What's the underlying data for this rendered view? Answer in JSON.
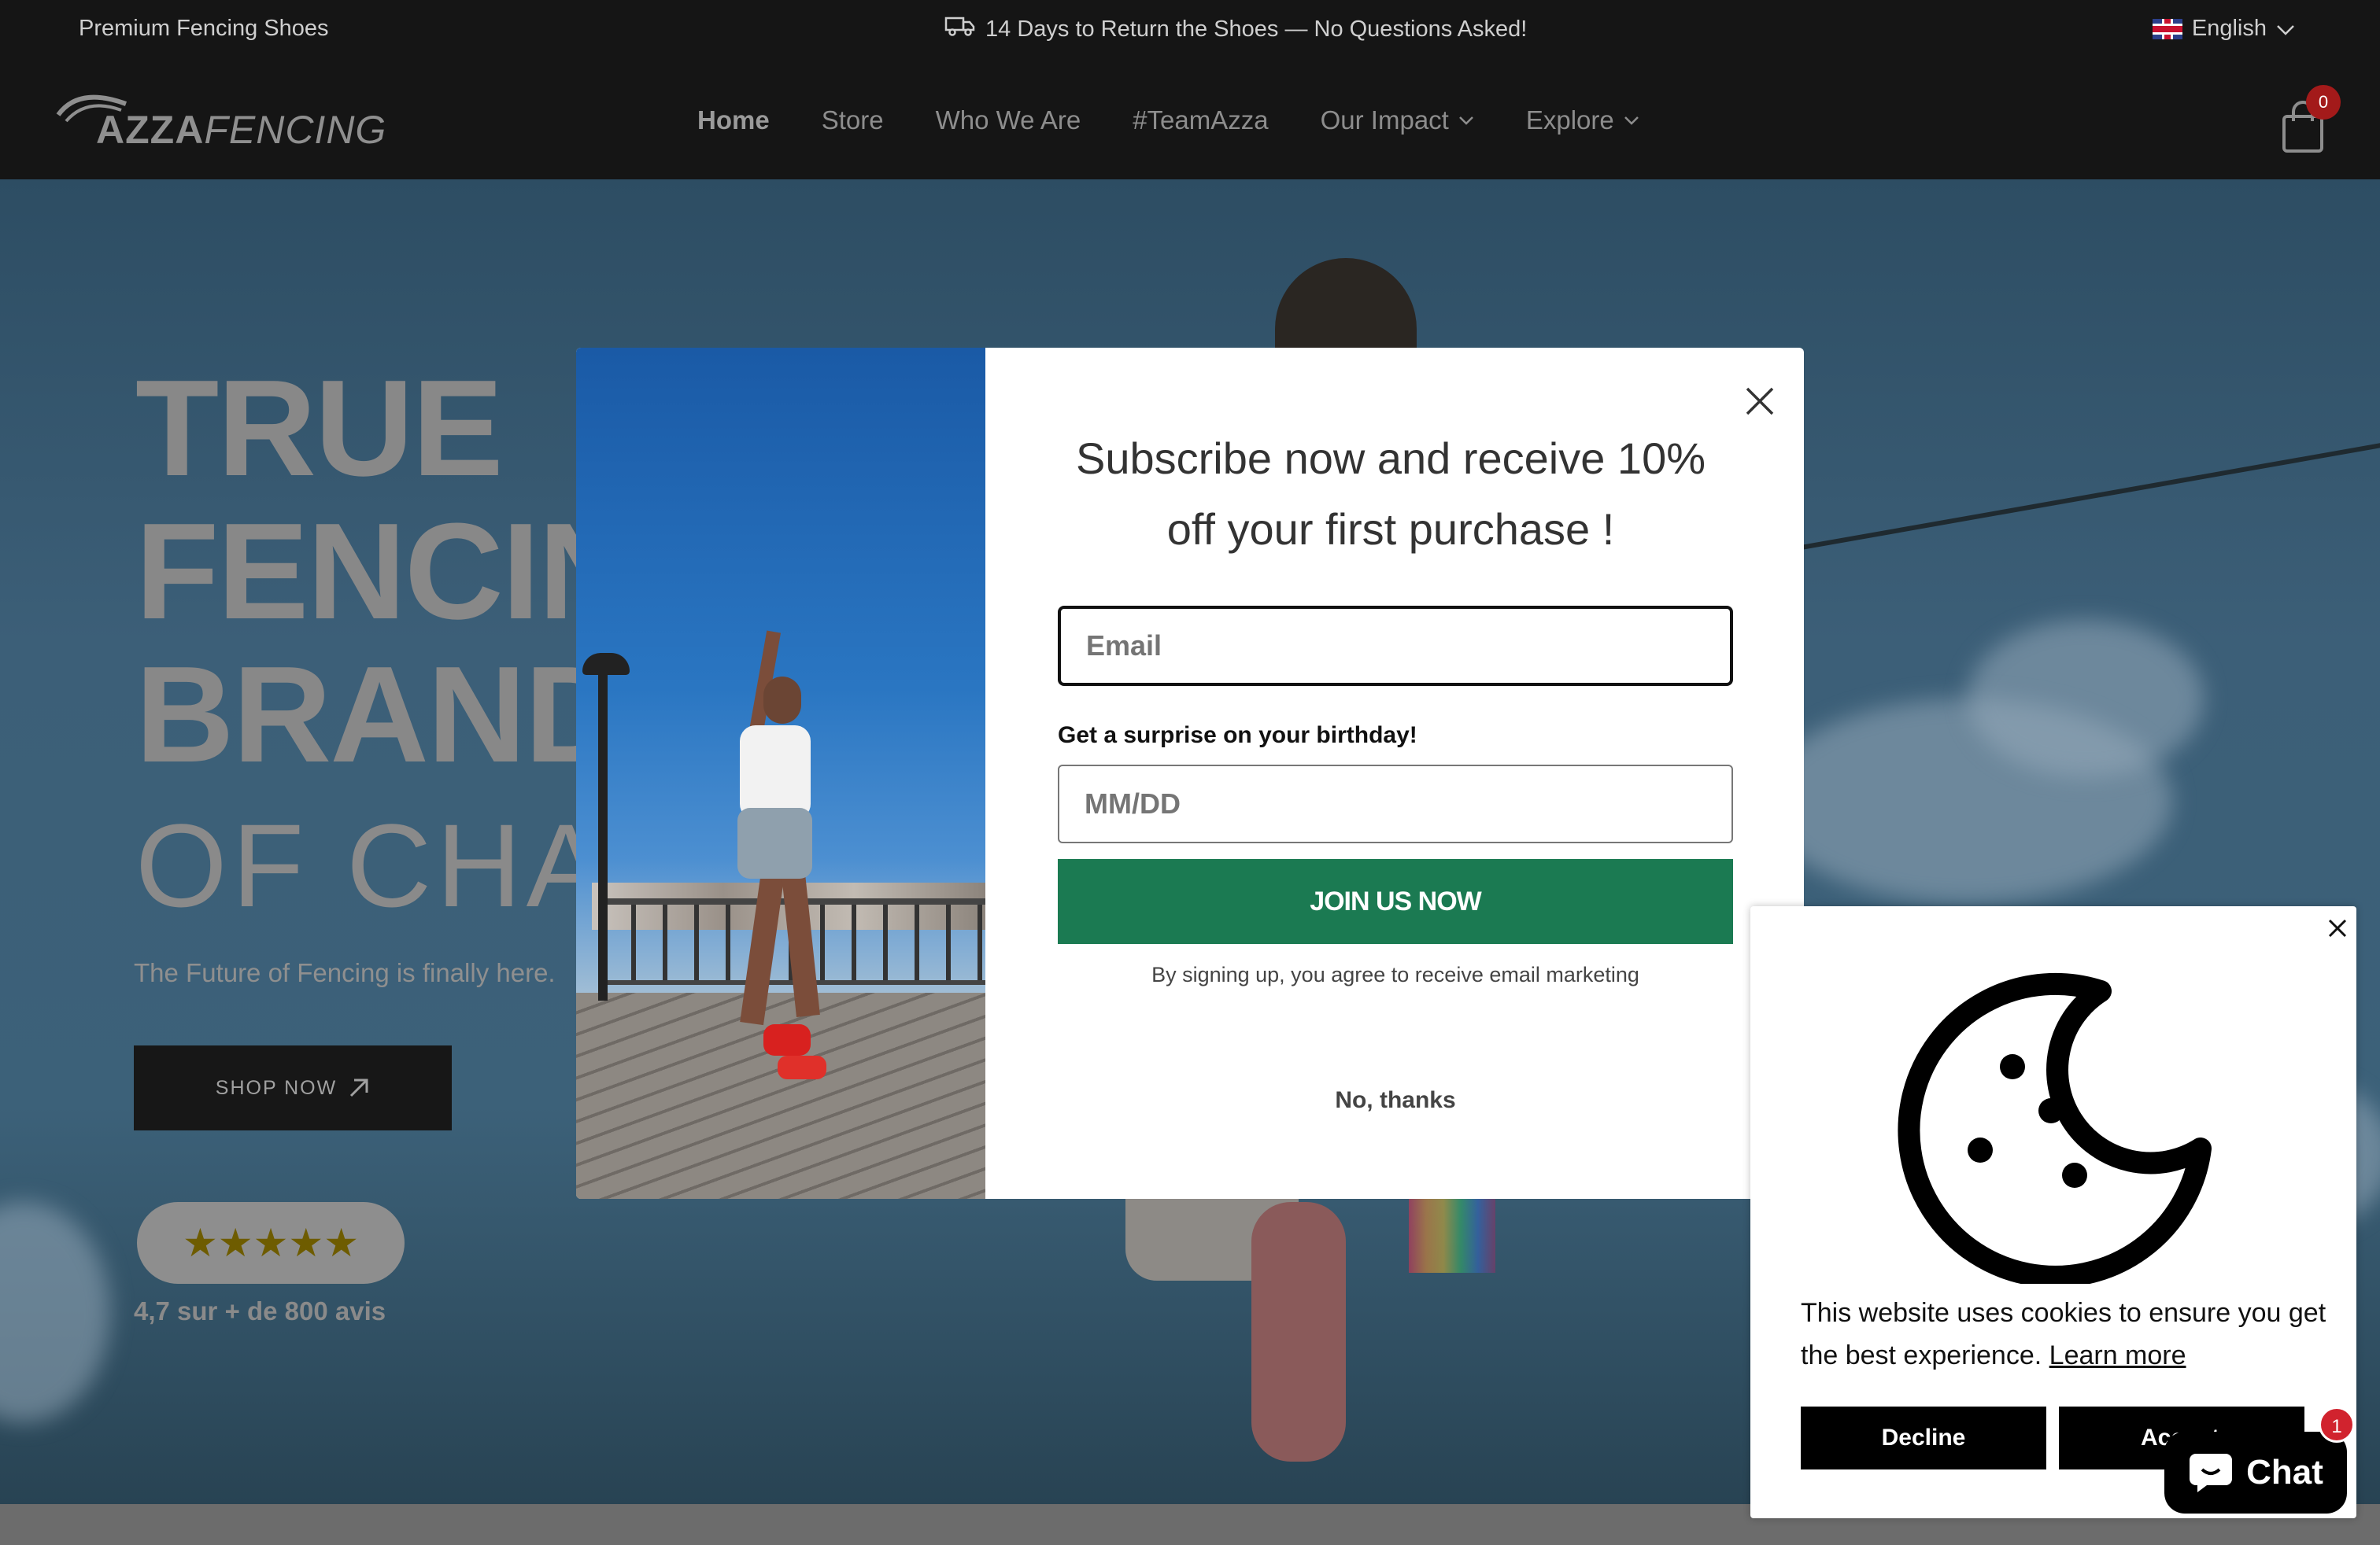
{
  "announcement": {
    "left_text": "Premium Fencing Shoes",
    "center_text": "14 Days to Return the Shoes — No Questions Asked!",
    "language": "English"
  },
  "header": {
    "logo_bold": "AZZA",
    "logo_light": "FENCING",
    "nav": [
      {
        "label": "Home",
        "active": true
      },
      {
        "label": "Store"
      },
      {
        "label": "Who We Are"
      },
      {
        "label": "#TeamAzza"
      },
      {
        "label": "Our Impact"
      },
      {
        "label": "Explore"
      }
    ],
    "cart_count": "0"
  },
  "hero": {
    "title_lines": [
      "TRUE",
      "FENCIN",
      "BRAND",
      "OF CHA"
    ],
    "subtitle": "The Future of Fencing is finally here.",
    "cta": "SHOP NOW",
    "stars": "★★★★★",
    "reviews": "4,7 sur + de 800 avis"
  },
  "modal": {
    "title": "Subscribe now and receive 10% off your first purchase !",
    "email_placeholder": "Email",
    "birthday_label": "Get a surprise on your birthday!",
    "date_placeholder": "MM/DD",
    "submit": "JOIN US NOW",
    "disclaimer": "By signing up, you agree to receive email marketing",
    "dismiss": "No, thanks"
  },
  "cookie": {
    "text": "This website uses cookies to ensure you get the best experience.",
    "learn_more": "Learn more",
    "decline": "Decline",
    "accept": "Accept"
  },
  "chat": {
    "label": "Chat",
    "badge": "1"
  },
  "colors": {
    "join_button": "#1b7a52",
    "cart_badge": "#a31a1a",
    "chat_badge": "#d1232e"
  }
}
